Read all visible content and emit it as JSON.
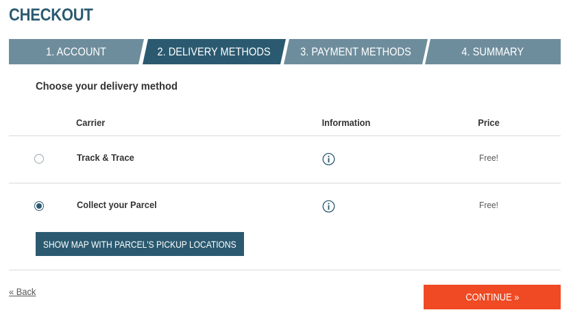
{
  "page": {
    "title": "CHECKOUT"
  },
  "steps": [
    {
      "label": "1. ACCOUNT",
      "active": false
    },
    {
      "label": "2. DELIVERY METHODS",
      "active": true
    },
    {
      "label": "3. PAYMENT METHODS",
      "active": false
    },
    {
      "label": "4. SUMMARY",
      "active": false
    }
  ],
  "delivery": {
    "heading": "Choose your delivery method",
    "columns": {
      "carrier": "Carrier",
      "information": "Information",
      "price": "Price"
    },
    "options": [
      {
        "carrier": "Track & Trace",
        "price": "Free!",
        "selected": false,
        "info_icon": "info-circle-icon"
      },
      {
        "carrier": "Collect your Parcel",
        "price": "Free!",
        "selected": true,
        "info_icon": "info-circle-icon"
      }
    ],
    "map_button_label": "SHOW MAP WITH PARCEL'S PICKUP LOCATIONS"
  },
  "footer": {
    "back_label": "« Back",
    "continue_label": "CONTINUE »"
  },
  "colors": {
    "primary": "#2b5a70",
    "step_inactive": "#6e8d9c",
    "accent": "#ef4a23",
    "rule": "#d9d9d9"
  }
}
